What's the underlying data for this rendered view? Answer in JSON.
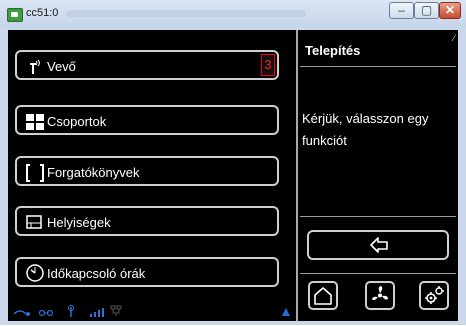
{
  "window": {
    "title": "cc51:0",
    "min_glyph": "–",
    "max_glyph": "▢",
    "close_glyph": "✕"
  },
  "menu": {
    "items": [
      {
        "label": "Vevő",
        "icon": "receiver-icon",
        "badge": "3"
      },
      {
        "label": "Csoportok",
        "icon": "groups-icon"
      },
      {
        "label": "Forgatókönyvek",
        "icon": "scenarios-icon"
      },
      {
        "label": "Helyiségek",
        "icon": "rooms-icon"
      },
      {
        "label": "Időkapcsoló órák",
        "icon": "clock-icon"
      }
    ]
  },
  "side": {
    "title": "Telepítés",
    "message": "Kérjük, válasszon egy funkciót"
  },
  "colors": {
    "panel": "#000000",
    "border": "#cfcfcf",
    "badge": "#ff2020",
    "status_blue": "#1e6fd9"
  }
}
